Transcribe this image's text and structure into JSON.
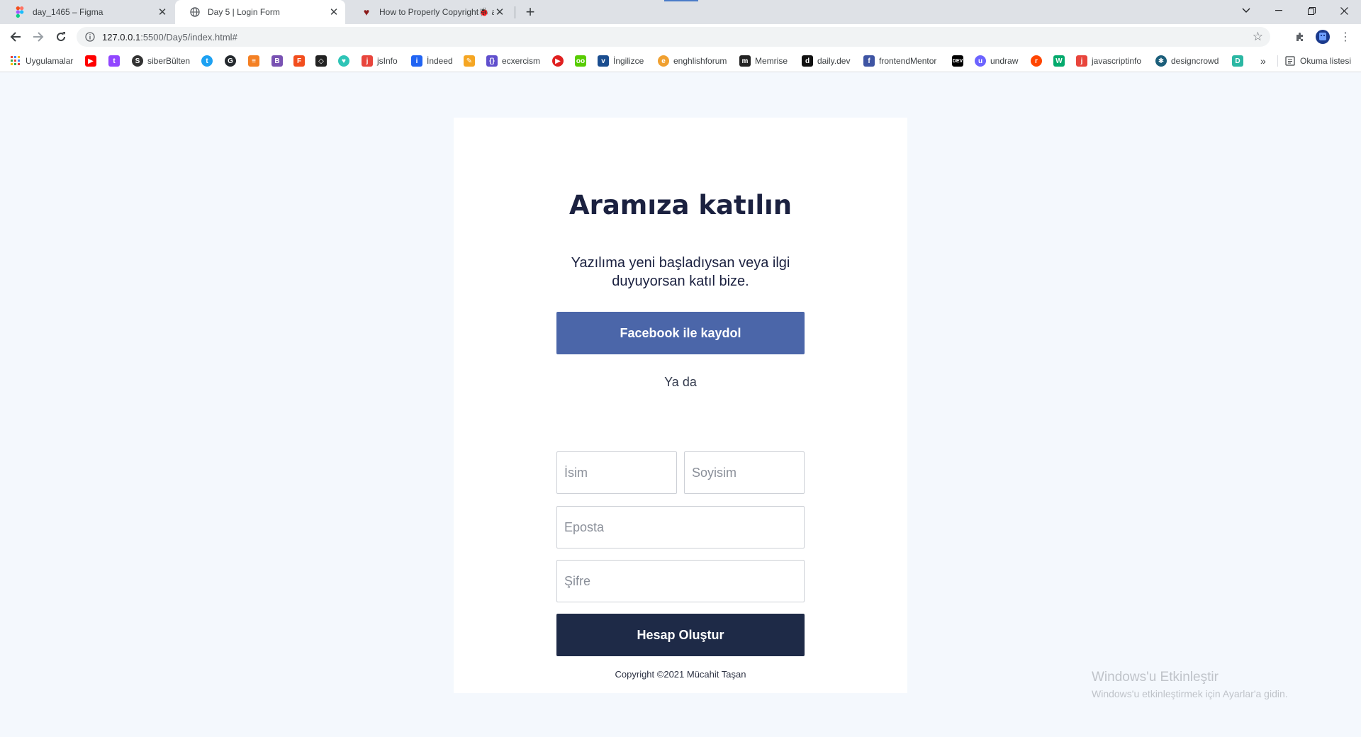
{
  "tabs": [
    {
      "title": "day_1465 – Figma",
      "active": false
    },
    {
      "title": "Day 5 | Login Form",
      "active": true
    },
    {
      "title": "How to Properly Copyright🐞 a",
      "active": false
    }
  ],
  "address": {
    "url_host": "127.0.0.1",
    "url_rest": ":5500/Day5/index.html#"
  },
  "bookmarks": {
    "apps": "Uygulamalar",
    "siberbulten": "siberBülten",
    "jsinfo": "jsInfo",
    "indeed": "İndeed",
    "ecxercism": "ecxercism",
    "ingilizce": "İngilizce",
    "englishforum": "enghlishforum",
    "memrise": "Memrise",
    "dailydev": "daily.dev",
    "frontendmentor": "frontendMentor",
    "undraw": "undraw",
    "javascriptinfo": "javascriptinfo",
    "designcrowd": "designcrowd",
    "more": "»",
    "reading_list": "Okuma listesi"
  },
  "form": {
    "heading": "Aramıza katılın",
    "subtitle": "Yazılıma yeni başladıysan veya ilgi duyuyorsan katıl bize.",
    "facebook_label": "Facebook ile kaydol",
    "or_text": "Ya da",
    "first_name_placeholder": "İsim",
    "last_name_placeholder": "Soyisim",
    "email_placeholder": "Eposta",
    "password_placeholder": "Şifre",
    "create_label": "Hesap Oluştur",
    "copyright": "Copyright ©2021 Mücahit Taşan"
  },
  "watermark": {
    "line1": "Windows'u Etkinleştir",
    "line2": "Windows'u etkinleştirmek için Ayarlar'a gidin."
  },
  "colors": {
    "facebook": "#4b66a9",
    "primary_dark": "#1e2a47",
    "page_bg": "#f4f8fd"
  }
}
